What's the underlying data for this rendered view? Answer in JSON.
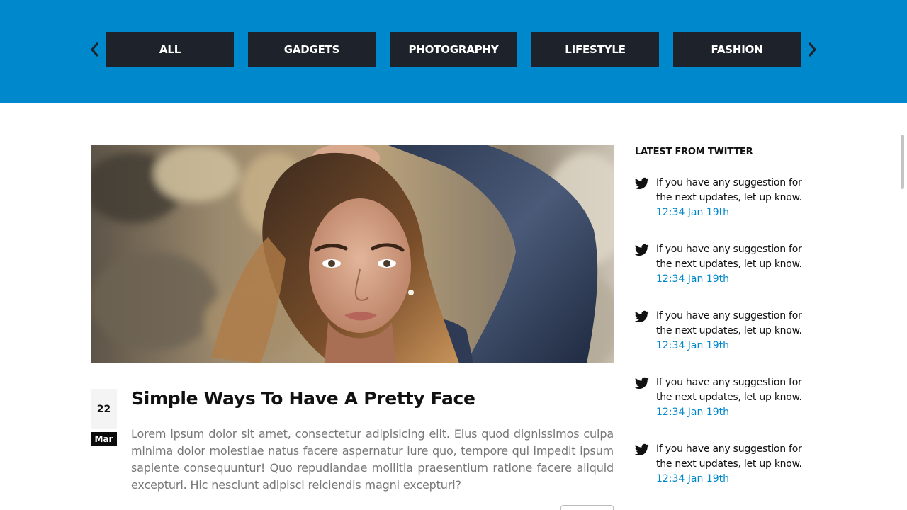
{
  "categories": [
    "ALL",
    "GADGETS",
    "PHOTOGRAPHY",
    "LIFESTYLE",
    "FASHION"
  ],
  "colors": {
    "accent_blue": "#0088cc",
    "category_bg": "#1e232b",
    "link": "#0088cc"
  },
  "icons": {
    "prev": "chevron-left-icon",
    "next": "chevron-right-icon",
    "tweet": "twitter-bird-icon"
  },
  "post": {
    "image_alt": "Young woman with freckles and long hair wearing a denim jacket",
    "date_day": "22",
    "date_month": "Mar",
    "title": "Simple Ways To Have A Pretty Face",
    "excerpt": "Lorem ipsum dolor sit amet, consectetur adipisicing elit. Eius quod dignissimos culpa minima dolor molestiae natus facere aspernatur iure quo, tempore qui impedit ipsum sapiente consequuntur! Quo repudiandae mollitia praesentium ratione facere aliquid excepturi. Hic nesciunt adipisci reiciendis magni excepturi?"
  },
  "sidebar": {
    "title": "LATEST FROM TWITTER",
    "tweets": [
      {
        "text": "If you have any suggestion for the next updates, let up know.",
        "time": "12:34 Jan 19th"
      },
      {
        "text": "If you have any suggestion for the next updates, let up know.",
        "time": "12:34 Jan 19th"
      },
      {
        "text": "If you have any suggestion for the next updates, let up know.",
        "time": "12:34 Jan 19th"
      },
      {
        "text": "If you have any suggestion for the next updates, let up know.",
        "time": "12:34 Jan 19th"
      },
      {
        "text": "If you have any suggestion for the next updates, let up know.",
        "time": "12:34 Jan 19th"
      }
    ]
  }
}
